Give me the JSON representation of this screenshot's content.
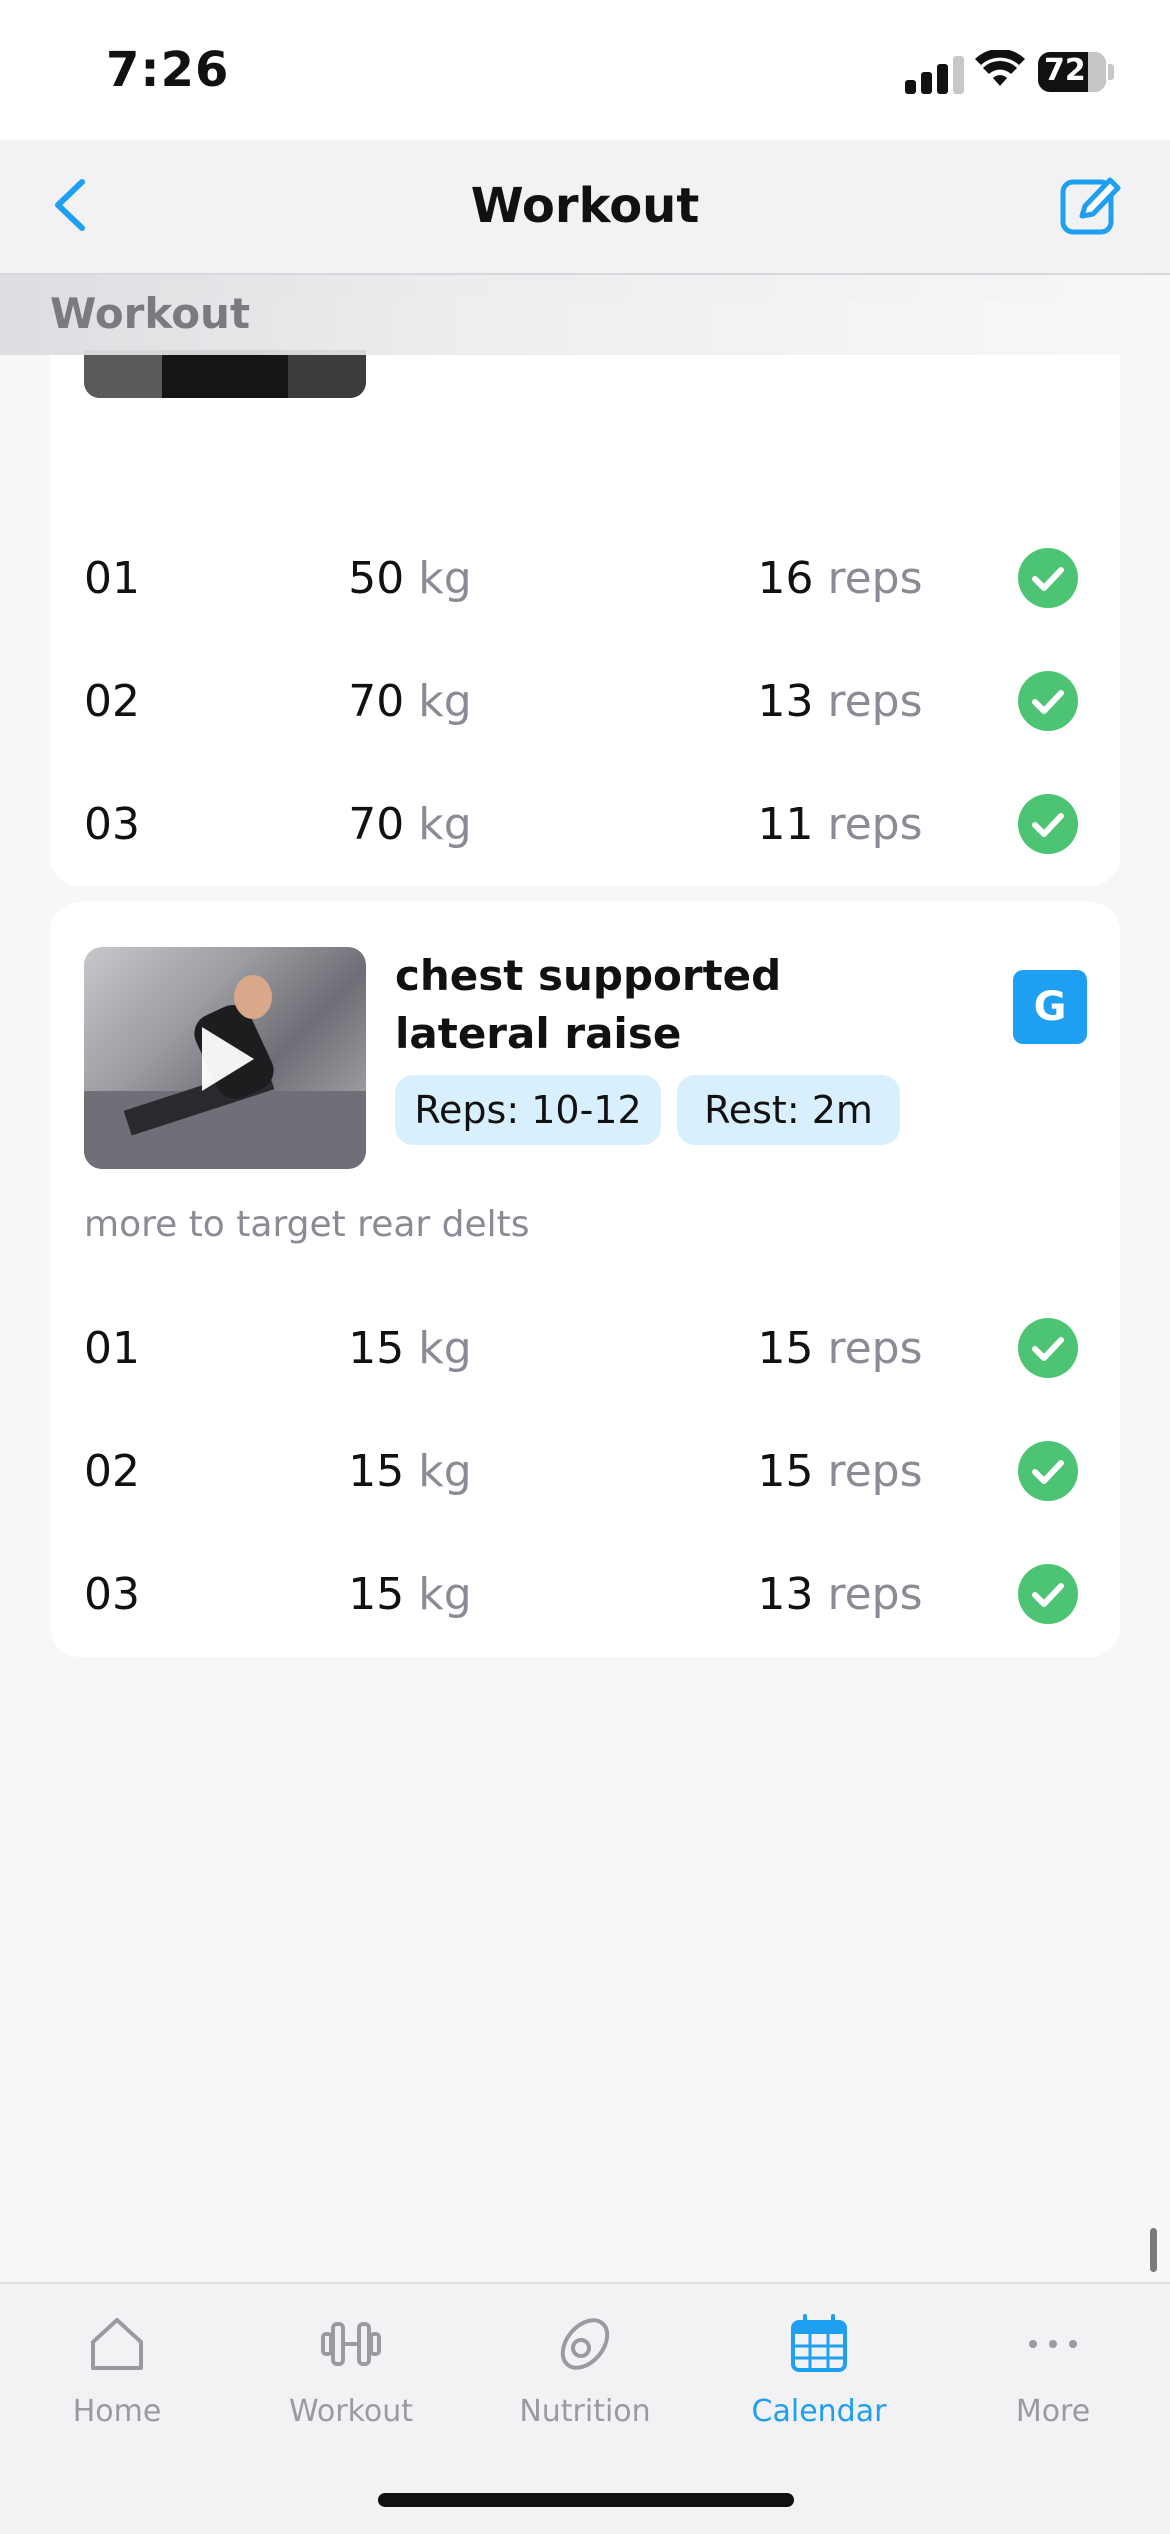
{
  "status_bar": {
    "time": "7:26",
    "battery": "72"
  },
  "nav": {
    "title": "Workout"
  },
  "section_header": "Workout",
  "exercises": [
    {
      "sets": [
        {
          "num": "01",
          "weight": "50",
          "weight_unit": "kg",
          "reps": "16",
          "reps_unit": "reps",
          "done": true
        },
        {
          "num": "02",
          "weight": "70",
          "weight_unit": "kg",
          "reps": "13",
          "reps_unit": "reps",
          "done": true
        },
        {
          "num": "03",
          "weight": "70",
          "weight_unit": "kg",
          "reps": "11",
          "reps_unit": "reps",
          "done": true
        }
      ]
    },
    {
      "title_line1": "chest supported",
      "title_line2": "lateral raise",
      "badge": "G",
      "reps_pill": "Reps: 10-12",
      "rest_pill": "Rest: 2m",
      "note": "more to target rear delts",
      "sets": [
        {
          "num": "01",
          "weight": "15",
          "weight_unit": "kg",
          "reps": "15",
          "reps_unit": "reps",
          "done": true
        },
        {
          "num": "02",
          "weight": "15",
          "weight_unit": "kg",
          "reps": "15",
          "reps_unit": "reps",
          "done": true
        },
        {
          "num": "03",
          "weight": "15",
          "weight_unit": "kg",
          "reps": "13",
          "reps_unit": "reps",
          "done": true
        }
      ]
    }
  ],
  "tabs": [
    {
      "label": "Home",
      "icon": "home-icon"
    },
    {
      "label": "Workout",
      "icon": "dumbbell-icon"
    },
    {
      "label": "Nutrition",
      "icon": "avocado-icon"
    },
    {
      "label": "Calendar",
      "icon": "calendar-icon",
      "active": true
    },
    {
      "label": "More",
      "icon": "more-icon"
    }
  ],
  "colors": {
    "accent": "#1e9ff2",
    "check": "#4cc473",
    "pill": "#d8f0fd"
  }
}
